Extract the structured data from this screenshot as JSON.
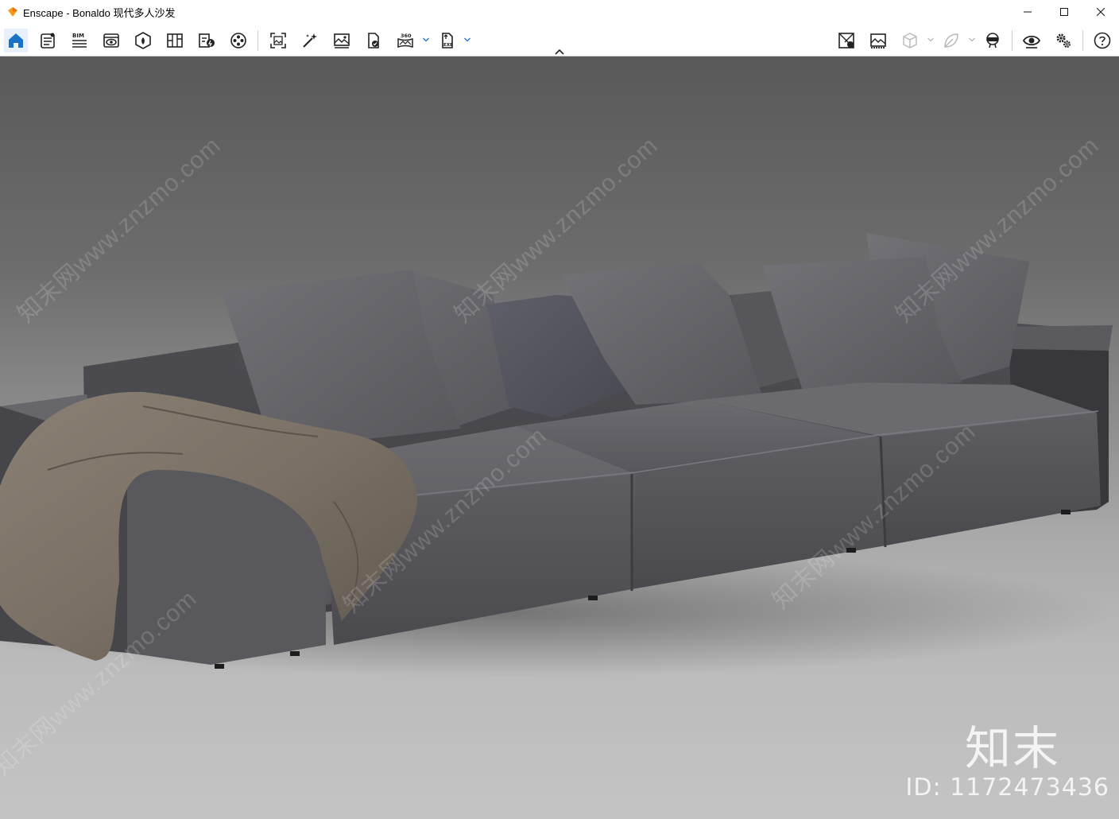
{
  "window": {
    "title": "Enscape - Bonaldo 现代多人沙发",
    "controls": {
      "minimize": "minimize-icon",
      "maximize": "maximize-icon",
      "close": "close-icon"
    }
  },
  "toolbar": {
    "left_tools": [
      {
        "icon": "home-icon",
        "active": true
      },
      {
        "icon": "settings-list-icon"
      },
      {
        "icon": "bim-icon",
        "badge": "BIM"
      },
      {
        "icon": "view-management-icon"
      },
      {
        "icon": "asset-library-icon"
      },
      {
        "icon": "material-editor-icon"
      },
      {
        "icon": "sun-study-icon"
      },
      {
        "icon": "video-editor-icon"
      },
      {
        "icon": "screenshot-icon"
      },
      {
        "icon": "render-enhance-icon"
      },
      {
        "icon": "batch-render-icon"
      },
      {
        "icon": "safe-frame-icon"
      },
      {
        "icon": "panorama-icon",
        "badge": "360"
      },
      {
        "icon": "export-exe-icon",
        "badge": "EXE"
      }
    ],
    "right_tools": [
      {
        "icon": "map-overlay-icon"
      },
      {
        "icon": "visual-settings-icon"
      },
      {
        "icon": "section-box-icon"
      },
      {
        "icon": "leaf-icon"
      },
      {
        "icon": "vr-headset-icon"
      },
      {
        "icon": "live-view-icon"
      },
      {
        "icon": "settings-gear-icon"
      },
      {
        "icon": "help-icon"
      }
    ]
  },
  "viewport": {
    "watermark_text": "知末网www.znzmo.com",
    "brand_mark": "知末",
    "brand_id": "ID: 1172473436"
  }
}
